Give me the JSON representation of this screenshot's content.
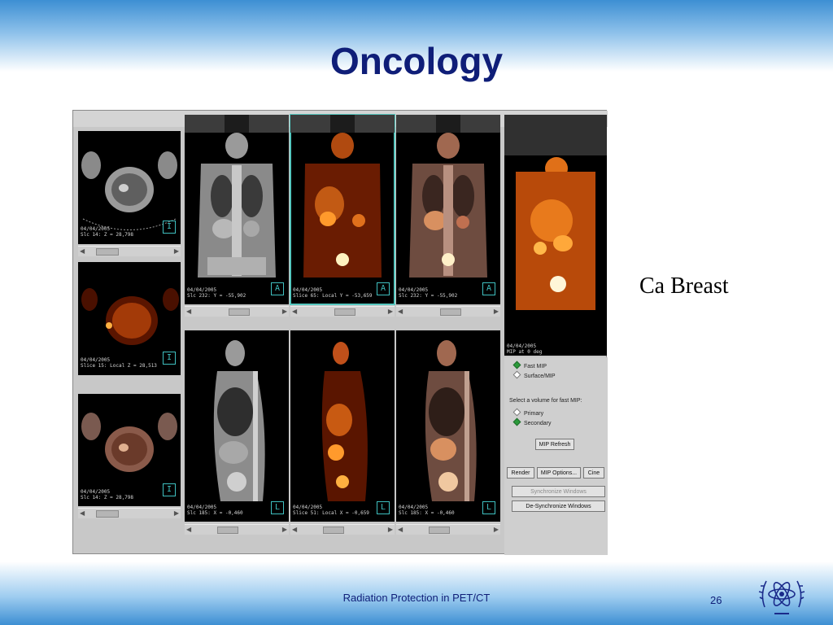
{
  "slide": {
    "title": "Oncology",
    "caption": "Ca Breast",
    "footer": "Radiation Protection in PET/CT",
    "page_number": "26"
  },
  "viewer": {
    "axial_panels": [
      {
        "date": "04/04/2005",
        "slice": "Slc 14: Z = 28,798",
        "orientation": "I"
      },
      {
        "date": "04/04/2005",
        "slice": "Slice 15: Local Z = 28,513",
        "orientation": "I"
      },
      {
        "date": "04/04/2005",
        "slice": "Slc 14: Z = 28,798",
        "orientation": "I"
      }
    ],
    "coronal_panels": [
      {
        "date": "04/04/2005",
        "slice": "Slc 232: Y = -55,902",
        "orientation": "A"
      },
      {
        "date": "04/04/2005",
        "slice": "Slice 65: Local Y = -53,659",
        "orientation": "A"
      },
      {
        "date": "04/04/2005",
        "slice": "Slc 232: Y = -55,902",
        "orientation": "A"
      }
    ],
    "sagittal_panels": [
      {
        "date": "04/04/2005",
        "slice": "Slc 185: X = -0,460",
        "orientation": "L"
      },
      {
        "date": "04/04/2005",
        "slice": "Slice 51: Local X = -0,659",
        "orientation": "L"
      },
      {
        "date": "04/04/2005",
        "slice": "Slc 185: X = -0,460",
        "orientation": "L"
      }
    ],
    "mip_panel": {
      "date": "04/04/2005",
      "info": "MIP at 0 deg"
    },
    "controls": {
      "mode_options": [
        {
          "label": "Fast MIP",
          "selected": true
        },
        {
          "label": "Surface/MIP",
          "selected": false
        }
      ],
      "volume_prompt": "Select a volume for fast MIP:",
      "volume_options": [
        {
          "label": "Primary",
          "selected": false
        },
        {
          "label": "Secondary",
          "selected": true
        }
      ],
      "mip_refresh": "MIP Refresh",
      "render": "Render",
      "mip_options": "MIP Options...",
      "cine": "Cine",
      "synchronize": "Synchronize Windows",
      "desynchronize": "De-Synchronize Windows"
    }
  },
  "colors": {
    "title": "#0f1e78",
    "band": "#3d8fd3",
    "selection": "#56c8c0",
    "pet_hot": "#ff8a1c",
    "pet_dark": "#5a1500"
  }
}
